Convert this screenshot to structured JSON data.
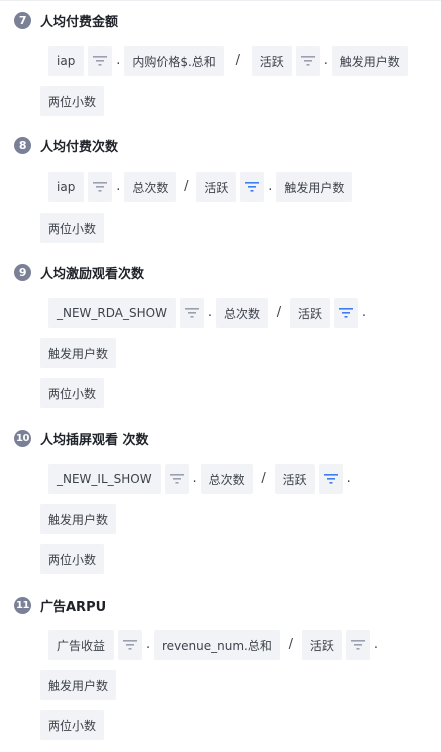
{
  "colors": {
    "badge_bg": "#7a8196",
    "tag_bg": "#f2f3f6",
    "filter_inactive": "#9aa0ad",
    "filter_active": "#3d7df0"
  },
  "sections": [
    {
      "badge": "7",
      "title": "人均付费金额",
      "tokens": {
        "t1": "iap",
        "dot1": ".",
        "t2": "内购价格$.总和",
        "op": "/",
        "t3": "活跃",
        "dot2": ".",
        "t4": "触发用户数",
        "fmt": "两位小数"
      }
    },
    {
      "badge": "8",
      "title": "人均付费次数",
      "tokens": {
        "t1": "iap",
        "dot1": ".",
        "t2": "总次数",
        "op": "/",
        "t3": "活跃",
        "dot2": ".",
        "t4": "触发用户数",
        "fmt": "两位小数"
      }
    },
    {
      "badge": "9",
      "title": "人均激励观看次数",
      "tokens": {
        "t1": "_NEW_RDA_SHOW",
        "dot1": ".",
        "t2": "总次数",
        "op": "/",
        "t3": "活跃",
        "dot2": ".",
        "t4": "触发用户数",
        "fmt": "两位小数"
      }
    },
    {
      "badge": "10",
      "title": "人均插屏观看 次数",
      "tokens": {
        "t1": "_NEW_IL_SHOW",
        "dot1": ".",
        "t2": "总次数",
        "op": "/",
        "t3": "活跃",
        "dot2": ".",
        "t4": "触发用户数",
        "fmt": "两位小数"
      }
    },
    {
      "badge": "11",
      "title": "广告ARPU",
      "tokens": {
        "t1": "广告收益",
        "dot1": ".",
        "t2": "revenue_num.总和",
        "op": "/",
        "t3": "活跃",
        "dot2": ".",
        "t4": "触发用户数",
        "fmt": "两位小数"
      }
    }
  ]
}
